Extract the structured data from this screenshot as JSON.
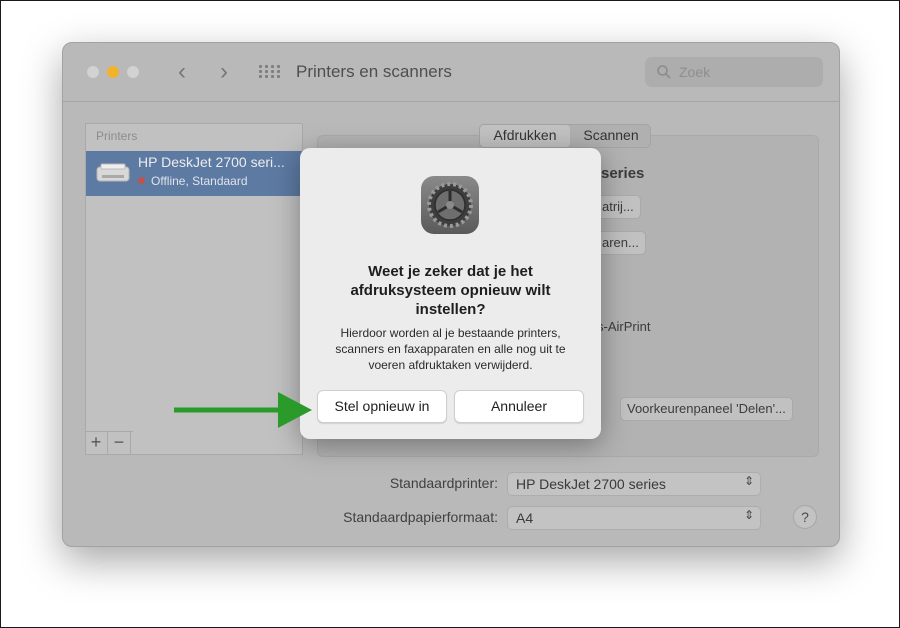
{
  "window": {
    "title": "Printers en scanners"
  },
  "search": {
    "placeholder": "Zoek"
  },
  "printers": {
    "header": "Printers",
    "items": [
      {
        "name": "HP DeskJet 2700 seri...",
        "status": "Offline, Standaard"
      }
    ]
  },
  "detail": {
    "tabs": [
      "Afdrukken",
      "Scannen"
    ],
    "name_fragment": "series",
    "button1_fragment": "atrij...",
    "button2_fragment": "aren...",
    "airprint_fragment": "s-AirPrint",
    "sharing_button": "Voorkeurenpaneel 'Delen'..."
  },
  "defaults": {
    "printer_label": "Standaardprinter:",
    "printer_value": "HP DeskJet 2700 series",
    "paper_label": "Standaardpapierformaat:",
    "paper_value": "A4"
  },
  "help": "?",
  "dialog": {
    "title": "Weet je zeker dat je het afdruksysteem opnieuw wilt instellen?",
    "message": "Hierdoor worden al je bestaande printers, scanners en faxapparaten en alle nog uit te voeren afdruktaken verwijderd.",
    "confirm": "Stel opnieuw in",
    "cancel": "Annuleer"
  },
  "colors": {
    "annotation_arrow": "#2a9a2a",
    "selection": "#5d7aa3"
  }
}
